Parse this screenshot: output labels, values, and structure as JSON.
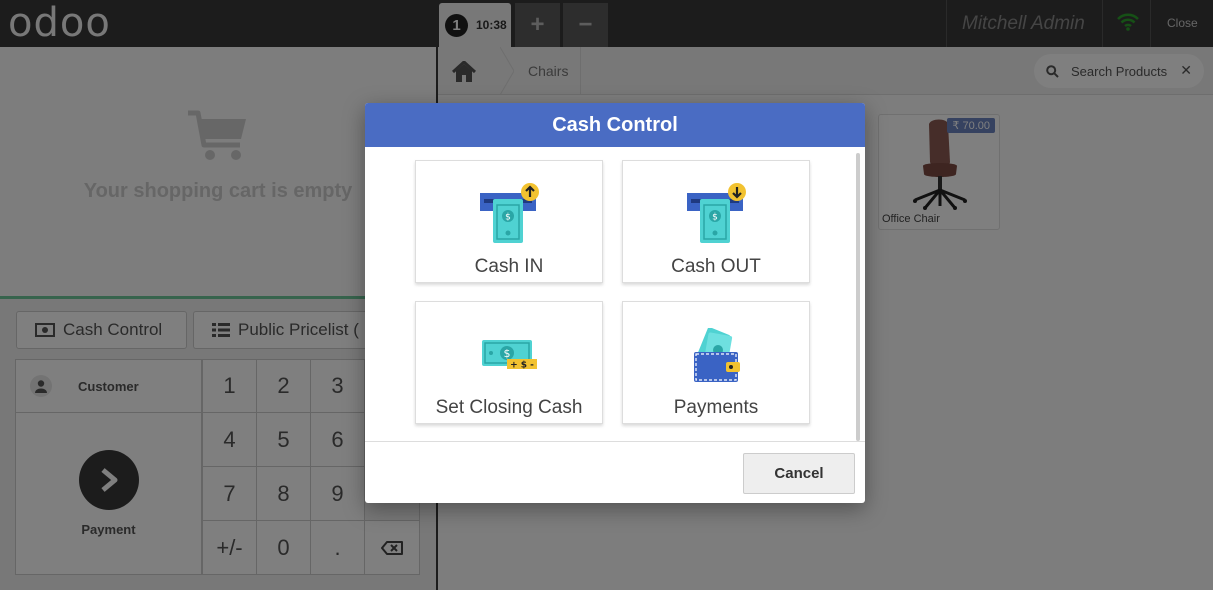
{
  "header": {
    "logo": "odoo",
    "order_number": "1",
    "order_time": "10:38",
    "add_order_label": "+",
    "remove_order_label": "−",
    "user_name": "Mitchell Admin",
    "close_label": "Close"
  },
  "cart": {
    "empty_text": "Your shopping cart is empty"
  },
  "controls": {
    "cash_control_label": "Cash Control",
    "pricelist_label": "Public Pricelist ("
  },
  "numpad": {
    "customer_label": "Customer",
    "payment_label": "Payment",
    "keys": [
      "1",
      "2",
      "3",
      "4",
      "5",
      "6",
      "7",
      "8",
      "9",
      "+/-",
      "0",
      "."
    ]
  },
  "products_screen": {
    "breadcrumb_category": "Chairs",
    "search_placeholder": "Search Products",
    "products": [
      {
        "name": "Office Chair",
        "price": "₹ 70.00"
      }
    ]
  },
  "modal": {
    "title": "Cash Control",
    "actions": [
      {
        "label": "Cash IN",
        "icon": "cash-in-icon"
      },
      {
        "label": "Cash OUT",
        "icon": "cash-out-icon"
      },
      {
        "label": "Set Closing Cash",
        "icon": "closing-cash-icon"
      },
      {
        "label": "Payments",
        "icon": "wallet-icon"
      }
    ],
    "cancel_label": "Cancel"
  },
  "colors": {
    "header_bg": "#393939",
    "modal_title_bg": "#4a6cc3",
    "cart_border": "#6ec89b",
    "price_tag_bg": "#6c84c0",
    "wifi_green": "#2ca02c"
  }
}
